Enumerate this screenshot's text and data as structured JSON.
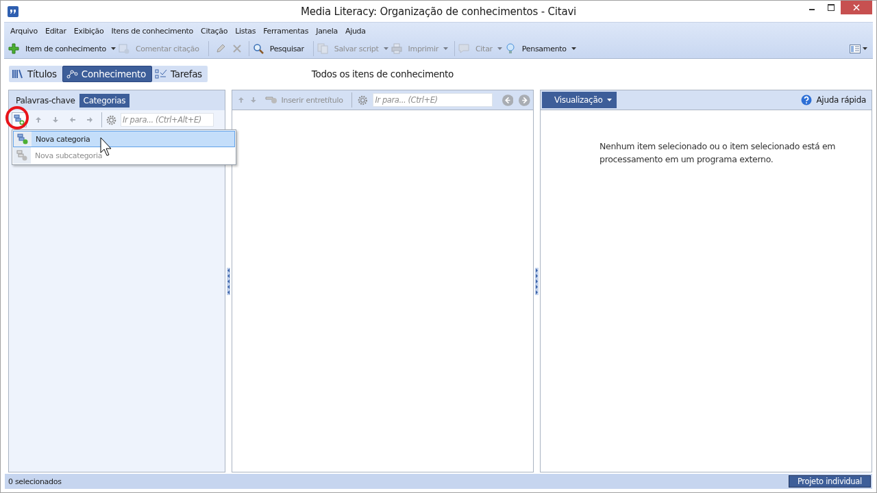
{
  "window": {
    "title": "Media Literacy: Organização de conhecimentos - Citavi"
  },
  "menu": [
    "Arquivo",
    "Editar",
    "Exibição",
    "Itens de conhecimento",
    "Citação",
    "Listas",
    "Ferramentas",
    "Janela",
    "Ajuda"
  ],
  "toolbar": [
    {
      "kind": "button",
      "label": "Item de conhecimento",
      "disabled": false,
      "dropdown": true
    },
    {
      "kind": "button",
      "label": "Comentar citação",
      "disabled": true,
      "dropdown": false
    },
    {
      "kind": "separator"
    },
    {
      "kind": "icon",
      "disabled": true
    },
    {
      "kind": "icon",
      "disabled": true
    },
    {
      "kind": "separator"
    },
    {
      "kind": "button",
      "label": "Pesquisar",
      "disabled": false,
      "dropdown": false
    },
    {
      "kind": "separator"
    },
    {
      "kind": "button",
      "label": "Salvar script",
      "disabled": true,
      "dropdown": true
    },
    {
      "kind": "button",
      "label": "Imprimir",
      "disabled": true,
      "dropdown": true
    },
    {
      "kind": "separator"
    },
    {
      "kind": "button",
      "label": "Citar",
      "disabled": true,
      "dropdown": true
    },
    {
      "kind": "button",
      "label": "Pensamento",
      "disabled": false,
      "dropdown": true
    }
  ],
  "nav_tabs": [
    {
      "label": "Títulos",
      "selected": false
    },
    {
      "label": "Conhecimento",
      "selected": true
    },
    {
      "label": "Tarefas",
      "selected": false
    }
  ],
  "heading": "Todos os itens de conhecimento",
  "left_pane": {
    "tabs": [
      {
        "label": "Palavras-chave",
        "selected": false
      },
      {
        "label": "Categorias",
        "selected": true
      }
    ],
    "search": {
      "placeholder": "Ir para... (Ctrl+Alt+E)"
    },
    "menu": [
      {
        "label": "Nova categoria",
        "selected": true,
        "disabled": false
      },
      {
        "label": "Nova subcategoria",
        "selected": false,
        "disabled": true
      }
    ]
  },
  "middle_pane": {
    "insert_button": {
      "label": "Inserir entretítulo",
      "disabled": true
    },
    "search": {
      "placeholder": "Ir para... (Ctrl+E)"
    }
  },
  "right_pane": {
    "view_button": "Visualização",
    "help_link": "Ajuda rápida",
    "message": "Nenhum item selecionado ou o item selecionado está em processamento em um programa externo."
  },
  "status_bar": {
    "selection": "0 selecionados",
    "project_button": "Projeto individual"
  }
}
